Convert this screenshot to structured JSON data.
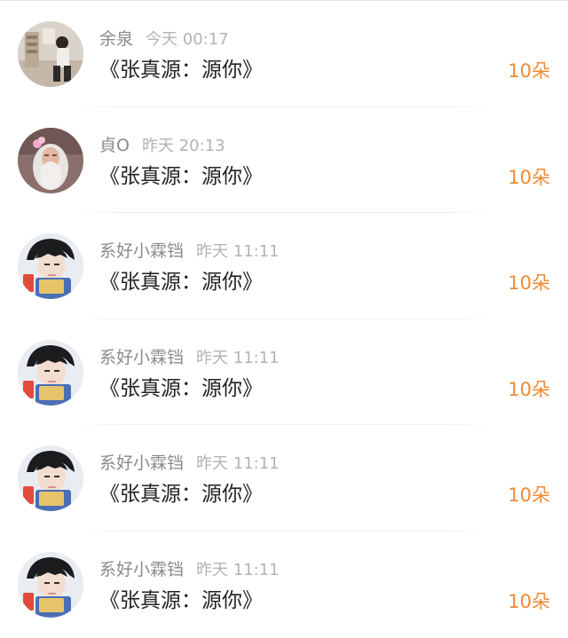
{
  "colors": {
    "name": "#8a8a8a",
    "time": "#b3b3b3",
    "message": "#222222",
    "gift_count": "#f08a33"
  },
  "comments": [
    {
      "avatar": "photo-avatar-room",
      "user": "余泉",
      "time": "今天 00:17",
      "text": "《张真源：源你》",
      "count": "10朵"
    },
    {
      "avatar": "photo-avatar-elder",
      "user": "貞O",
      "time": "昨天 20:13",
      "text": "《张真源：源你》",
      "count": "10朵"
    },
    {
      "avatar": "photo-avatar-boy",
      "user": "系好小霖铛",
      "time": "昨天 11:11",
      "text": "《张真源：源你》",
      "count": "10朵"
    },
    {
      "avatar": "photo-avatar-boy",
      "user": "系好小霖铛",
      "time": "昨天 11:11",
      "text": "《张真源：源你》",
      "count": "10朵"
    },
    {
      "avatar": "photo-avatar-boy",
      "user": "系好小霖铛",
      "time": "昨天 11:11",
      "text": "《张真源：源你》",
      "count": "10朵"
    },
    {
      "avatar": "photo-avatar-boy",
      "user": "系好小霖铛",
      "time": "昨天 11:11",
      "text": "《张真源：源你》",
      "count": "10朵"
    }
  ]
}
